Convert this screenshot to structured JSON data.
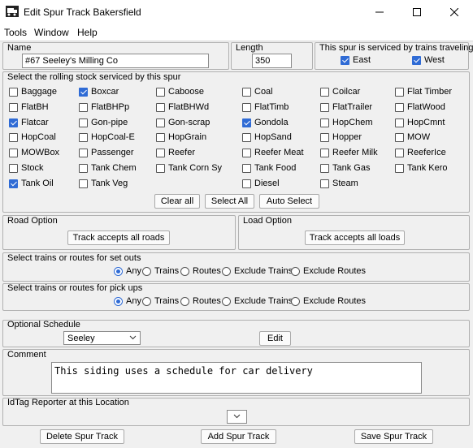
{
  "window": {
    "title": "Edit Spur Track Bakersfield"
  },
  "menu": [
    "Tools",
    "Window",
    "Help"
  ],
  "name": {
    "label": "Name",
    "value": "#67 Seeley's Milling Co"
  },
  "length": {
    "label": "Length",
    "value": "350"
  },
  "serviced": {
    "label": "This spur is serviced by trains traveling",
    "east": "East",
    "west": "West",
    "east_checked": true,
    "west_checked": true
  },
  "rolling_stock": {
    "label": "Select the rolling stock serviced by this spur",
    "items": [
      {
        "label": "Baggage",
        "checked": false
      },
      {
        "label": "Boxcar",
        "checked": true
      },
      {
        "label": "Caboose",
        "checked": false
      },
      {
        "label": "Coal",
        "checked": false
      },
      {
        "label": "Coilcar",
        "checked": false
      },
      {
        "label": "Flat Timber",
        "checked": false
      },
      {
        "label": "FlatBH",
        "checked": false
      },
      {
        "label": "FlatBHPp",
        "checked": false
      },
      {
        "label": "FlatBHWd",
        "checked": false
      },
      {
        "label": "FlatTimb",
        "checked": false
      },
      {
        "label": "FlatTrailer",
        "checked": false
      },
      {
        "label": "FlatWood",
        "checked": false
      },
      {
        "label": "Flatcar",
        "checked": true
      },
      {
        "label": "Gon-pipe",
        "checked": false
      },
      {
        "label": "Gon-scrap",
        "checked": false
      },
      {
        "label": "Gondola",
        "checked": true
      },
      {
        "label": "HopChem",
        "checked": false
      },
      {
        "label": "HopCmnt",
        "checked": false
      },
      {
        "label": "HopCoal",
        "checked": false
      },
      {
        "label": "HopCoal-E",
        "checked": false
      },
      {
        "label": "HopGrain",
        "checked": false
      },
      {
        "label": "HopSand",
        "checked": false
      },
      {
        "label": "Hopper",
        "checked": false
      },
      {
        "label": "MOW",
        "checked": false
      },
      {
        "label": "MOWBox",
        "checked": false
      },
      {
        "label": "Passenger",
        "checked": false
      },
      {
        "label": "Reefer",
        "checked": false
      },
      {
        "label": "Reefer Meat",
        "checked": false
      },
      {
        "label": "Reefer Milk",
        "checked": false
      },
      {
        "label": "ReeferIce",
        "checked": false
      },
      {
        "label": "Stock",
        "checked": false
      },
      {
        "label": "Tank Chem",
        "checked": false
      },
      {
        "label": "Tank Corn Sy",
        "checked": false
      },
      {
        "label": "Tank Food",
        "checked": false
      },
      {
        "label": "Tank Gas",
        "checked": false
      },
      {
        "label": "Tank Kero",
        "checked": false
      },
      {
        "label": "Tank Oil",
        "checked": true
      },
      {
        "label": "Tank Veg",
        "checked": false
      },
      null,
      {
        "label": "Diesel",
        "checked": false
      },
      {
        "label": "Steam",
        "checked": false
      },
      null
    ],
    "clear_all": "Clear all",
    "select_all": "Select All",
    "auto_select": "Auto Select"
  },
  "road_option": {
    "label": "Road Option",
    "button": "Track accepts all roads"
  },
  "load_option": {
    "label": "Load Option",
    "button": "Track accepts all loads"
  },
  "setouts": {
    "label": "Select trains or routes for set outs",
    "options": [
      "Any",
      "Trains",
      "Routes",
      "Exclude Trains",
      "Exclude Routes"
    ],
    "selected": "Any"
  },
  "pickups": {
    "label": "Select trains or routes for pick ups",
    "options": [
      "Any",
      "Trains",
      "Routes",
      "Exclude Trains",
      "Exclude Routes"
    ],
    "selected": "Any"
  },
  "schedule": {
    "label": "Optional Schedule",
    "value": "Seeley",
    "edit": "Edit"
  },
  "comment": {
    "label": "Comment",
    "value": "This siding uses a schedule for car delivery"
  },
  "idtag": {
    "label": "IdTag Reporter at this Location",
    "value": ""
  },
  "buttons": {
    "delete": "Delete Spur Track",
    "add": "Add Spur Track",
    "save": "Save Spur Track"
  },
  "colors": {
    "accent": "#2f6bd5",
    "background": "#f0f0f0"
  }
}
